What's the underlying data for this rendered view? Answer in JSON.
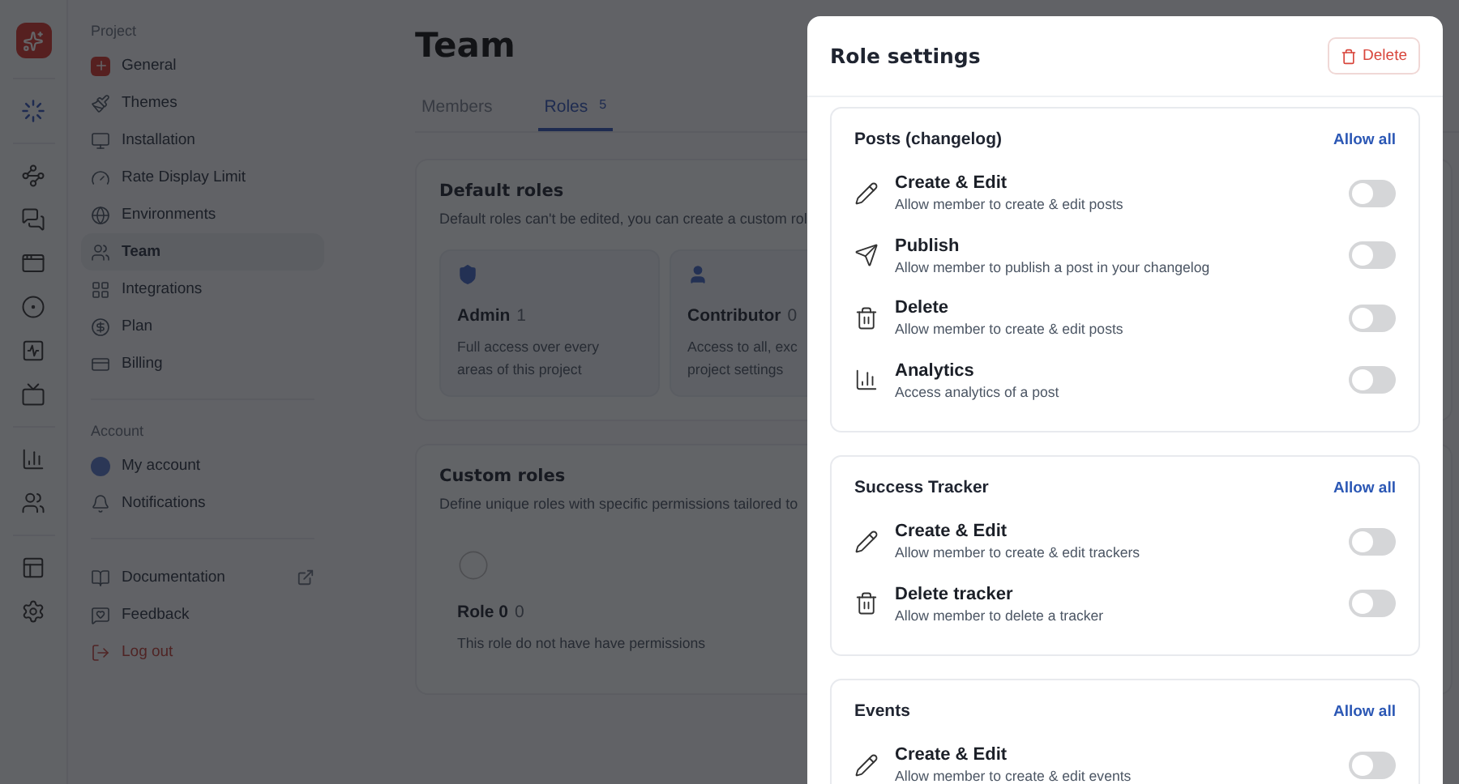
{
  "sidebar": {
    "sections": [
      {
        "heading": "Project",
        "items": [
          {
            "label": "General",
            "kind": "brand",
            "selected": false
          },
          {
            "label": "Themes",
            "kind": "normal",
            "selected": false
          },
          {
            "label": "Installation",
            "kind": "normal",
            "selected": false
          },
          {
            "label": "Rate Display Limit",
            "kind": "normal",
            "selected": false
          },
          {
            "label": "Environments",
            "kind": "normal",
            "selected": false
          },
          {
            "label": "Team",
            "kind": "normal",
            "selected": true
          },
          {
            "label": "Integrations",
            "kind": "normal",
            "selected": false
          },
          {
            "label": "Plan",
            "kind": "normal",
            "selected": false
          },
          {
            "label": "Billing",
            "kind": "normal",
            "selected": false
          }
        ]
      },
      {
        "heading": "Account",
        "items": [
          {
            "label": "My account",
            "kind": "avatar",
            "selected": false
          },
          {
            "label": "Notifications",
            "kind": "normal",
            "selected": false
          }
        ]
      },
      {
        "items": [
          {
            "label": "Documentation",
            "kind": "external",
            "selected": false
          },
          {
            "label": "Feedback",
            "kind": "normal",
            "selected": false
          },
          {
            "label": "Log out",
            "kind": "danger",
            "selected": false
          }
        ]
      }
    ]
  },
  "page": {
    "title": "Team",
    "tabs": [
      {
        "label": "Members",
        "selected": false
      },
      {
        "label": "Roles",
        "count": "5",
        "selected": true
      }
    ],
    "default_roles": {
      "title": "Default roles",
      "description": "Default roles can't be edited, you can create a custom rol",
      "roles": [
        {
          "kind": "admin",
          "name": "Admin",
          "count": "1",
          "lines": [
            "Full access over every",
            "areas of this project"
          ]
        },
        {
          "kind": "contributor",
          "name": "Contributor",
          "count": "0",
          "lines": [
            "Access to all, exc",
            "project settings"
          ]
        }
      ]
    },
    "custom_roles": {
      "title": "Custom roles",
      "description": "Define unique roles with specific permissions tailored to",
      "roles": [
        {
          "kind": "custom",
          "name": "Role 0",
          "count": "0",
          "lines": [
            "This role do not have have permissions"
          ]
        }
      ]
    }
  },
  "role_settings": {
    "title": "Role settings",
    "delete_label": "Delete",
    "groups": [
      {
        "title": "Posts (changelog)",
        "action": "Allow all",
        "permissions": [
          {
            "kind": "edit",
            "title": "Create & Edit",
            "description": "Allow member to create & edit posts",
            "on": false
          },
          {
            "kind": "publish",
            "title": "Publish",
            "description": "Allow member to publish a post in your changelog",
            "on": false
          },
          {
            "kind": "delete",
            "title": "Delete",
            "description": "Allow member to create & edit posts",
            "on": false
          },
          {
            "kind": "analytics",
            "title": "Analytics",
            "description": "Access analytics of a post",
            "on": false
          }
        ]
      },
      {
        "title": "Success Tracker",
        "action": "Allow all",
        "permissions": [
          {
            "kind": "edit",
            "title": "Create & Edit",
            "description": "Allow member to create & edit trackers",
            "on": false
          },
          {
            "kind": "delete",
            "title": "Delete tracker",
            "description": "Allow member to delete a tracker",
            "on": false
          }
        ]
      },
      {
        "title": "Events",
        "action": "Allow all",
        "permissions": [
          {
            "kind": "edit",
            "title": "Create & Edit",
            "description": "Allow member to create & edit events",
            "on": false
          }
        ]
      }
    ]
  }
}
